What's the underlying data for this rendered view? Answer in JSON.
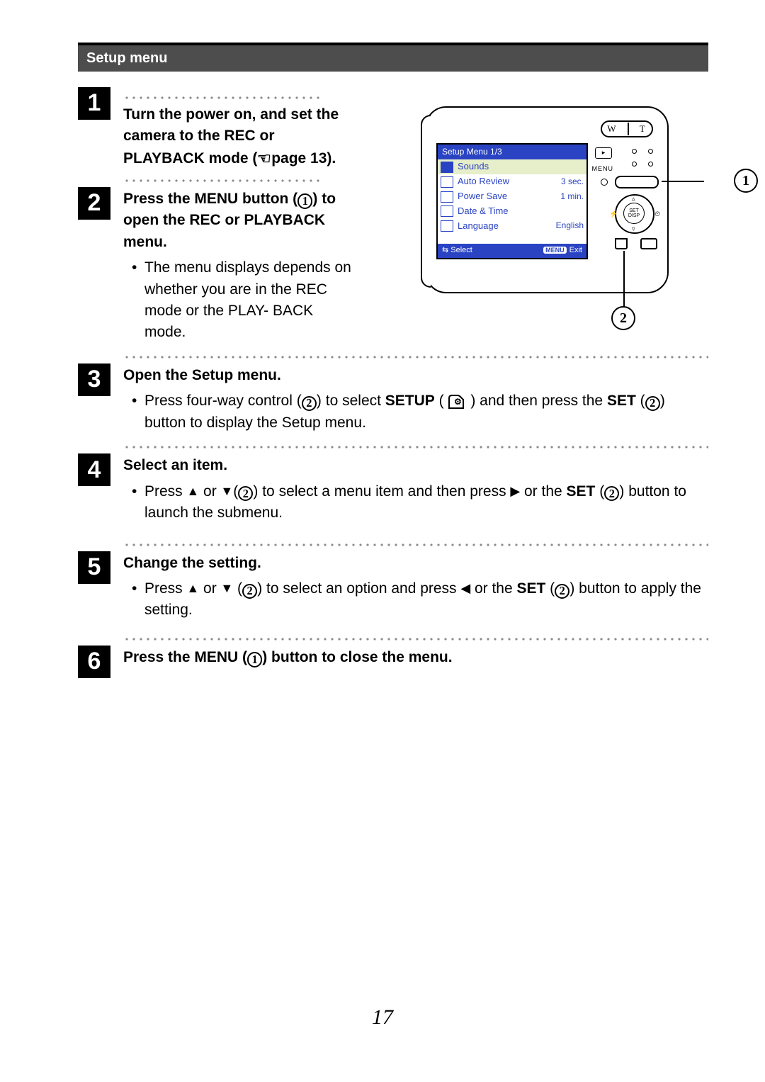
{
  "header": {
    "title": "Setup menu"
  },
  "steps": [
    {
      "num": "1",
      "head_pre": "Turn the power on, and set the camera to the REC or PLAYBACK mode (",
      "head_post": "page 13)."
    },
    {
      "num": "2",
      "head_pre": "Press the MENU button (",
      "head_post": ") to open the REC or PLAYBACK menu.",
      "bullets": [
        {
          "text": "The menu displays depends on whether you are in the REC mode or the PLAY- BACK mode."
        }
      ]
    },
    {
      "num": "3",
      "head": "Open the Setup menu.",
      "bullets": [
        {
          "pre": "Press four-way control (",
          "mid1": ") to select ",
          "strong1": "SETUP",
          "mid2": " ( ",
          "mid3": " ) and then press the ",
          "strong2": "SET",
          "mid4": " (",
          "post": ") button to display the Setup menu."
        }
      ]
    },
    {
      "num": "4",
      "head": "Select an item.",
      "bullets": [
        {
          "pre": "Press ",
          "mid1": " or ",
          "mid2": "(",
          "mid3": ") to select a menu item and then press ",
          "mid4": " or the ",
          "strong1": "SET",
          "mid5": " (",
          "post": ") button to launch the submenu."
        }
      ]
    },
    {
      "num": "5",
      "head": "Change the setting.",
      "bullets": [
        {
          "pre": "Press ",
          "mid1": " or ",
          "mid2": " (",
          "mid3": ") to select an option and press ",
          "mid4": " or the ",
          "strong1": "SET",
          "mid5": " (",
          "post": ") button to apply the setting."
        }
      ]
    },
    {
      "num": "6",
      "head_pre": "Press the MENU (",
      "head_post": ") button to close the menu."
    }
  ],
  "indicators": {
    "one": "1",
    "two": "2"
  },
  "diagram": {
    "wt_left": "W",
    "wt_right": "T",
    "menu_label": "MENU",
    "set_label": "SET",
    "disp_label": "DISP",
    "play_glyph": "▸",
    "callout_1": "❶",
    "callout_2": "❷",
    "screen": {
      "title": "Setup Menu 1/3",
      "rows": [
        {
          "label": "Sounds",
          "value": ""
        },
        {
          "label": "Auto Review",
          "value": "3 sec."
        },
        {
          "label": "Power Save",
          "value": "1 min."
        },
        {
          "label": "Date & Time",
          "value": ""
        },
        {
          "label": "Language",
          "value": "English"
        }
      ],
      "bottom_left": "⇆ Select",
      "bottom_right_badge": "MENU",
      "bottom_right": "Exit"
    }
  },
  "page_number": "17"
}
